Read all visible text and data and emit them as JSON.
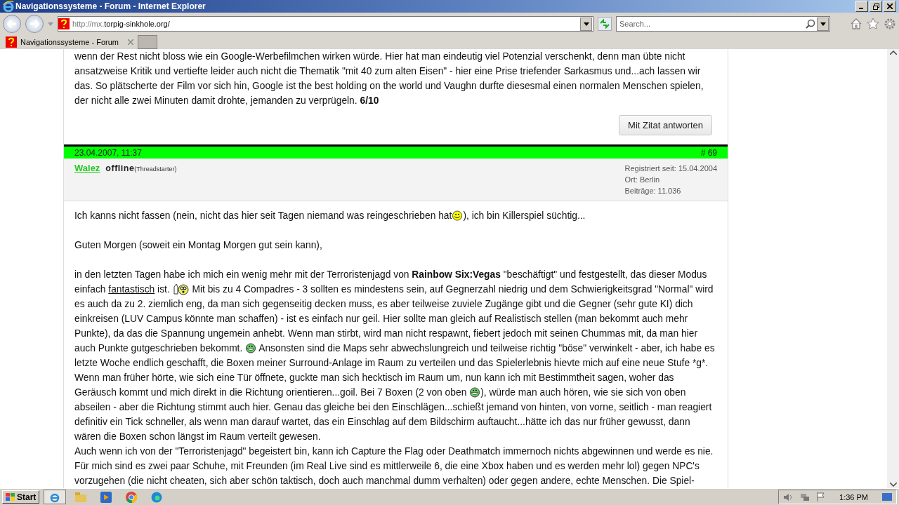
{
  "window": {
    "title": "Navigationssysteme - Forum - Internet Explorer"
  },
  "address": {
    "prefix": "http://mx.",
    "domain": "torpig-sinkhole.org/"
  },
  "search": {
    "placeholder": "Search..."
  },
  "tabs": [
    {
      "label": "Navigationssysteme - Forum",
      "selected": true
    }
  ],
  "previous_post": {
    "segments": [
      {
        "kind": "text",
        "text": "wenn der Rest nicht bloss wie ein Google-Werbefilmchen wirken würde. Hier hat man eindeutig viel Potenzial verschenkt, denn man übte nicht ansatzweise Kritik und vertiefte leider auch nicht die Thematik \"mit 40 zum alten Eisen\" - hier eine Prise triefender Sarkasmus und...ach lassen wir das. So plätscherte der Film vor sich hin, Google ist the best holding on the world und Vaughn durfte diesesmal einen normalen Menschen spielen, der nicht alle zwei Minuten damit drohte, jemanden zu verprügeln. **6/10**"
      }
    ],
    "quote_button": "Mit Zitat antworten"
  },
  "post": {
    "date": "23.04.2007, 11:37",
    "number": "# 69",
    "author": "Walez",
    "status": "offline",
    "role": "(Threadstarter)",
    "meta": [
      "Registriert seit: 15.04.2004",
      "Ort: Berlin",
      "Beiträge: 11.036"
    ],
    "paragraphs": [
      {
        "segments": [
          {
            "kind": "text",
            "text": "Ich kanns nicht fassen (nein, nicht das hier seit Tagen niemand was reingeschrieben hat"
          },
          {
            "kind": "smile"
          },
          {
            "kind": "text",
            "text": "), ich bin Killerspiel süchtig..."
          }
        ]
      },
      {
        "segments": [
          {
            "kind": "text",
            "text": "Guten Morgen (soweit ein Montag Morgen gut sein kann),"
          }
        ]
      },
      {
        "segments": [
          {
            "kind": "text",
            "text": "in den letzten Tagen habe ich mich ein wenig mehr mit der Terroristenjagd von **Rainbow Six:Vegas** \"beschäftigt\" und festgestellt, das dieser Modus einfach "
          },
          {
            "kind": "link",
            "text": "fantastisch"
          },
          {
            "kind": "text",
            "text": " ist. "
          },
          {
            "kind": "wow"
          },
          {
            "kind": "text",
            "text": " Mit bis zu 4 Compadres - 3 sollten es mindestens sein, auf Gegnerzahl niedrig und dem Schwierigkeitsgrad \"Normal\" wird es auch da zu 2. ziemlich eng, da man sich gegenseitig decken muss, es aber teilweise zuviele Zugänge gibt und die Gegner (sehr gute KI) dich einkreisen (LUV Campus könnte man schaffen) - ist es einfach nur geil. Hier sollte man gleich auf Realistisch stellen (man bekommt auch mehr Punkte), da das die Spannung ungemein anhebt. Wenn man stirbt, wird man nicht respawnt, fiebert jedoch mit seinen Chummas mit, da man hier auch Punkte gutgeschrieben bekommt. "
          },
          {
            "kind": "grin"
          },
          {
            "kind": "plain",
            "text": " Ansonsten sind die Maps sehr abwechslungreich und teilweise richtig \"böse\" verwinkelt - aber, ich habe es letzte Woche endlich geschafft, die Boxen meiner Surround-Anlage im Raum zu verteilen und das Spielerlebnis hievte mich auf eine neue Stufe *g*. Wenn man früher hörte, wie sich eine Tür öffnete, guckte man sich hecktisch im Raum um, nun kann ich mit Bestimmtheit sagen, woher das Geräusch kommt und mich direkt in die Richtung orientieren...goil. Bei 7 Boxen (2 von oben "
          },
          {
            "kind": "grin"
          },
          {
            "kind": "text",
            "text": "), würde man auch hören, wie sie sich von oben abseilen - aber die Richtung stimmt auch hier. Genau das gleiche bei den Einschlägen...schießt jemand von hinten, von vorne, seitlich - man reagiert definitiv ein Tick schneller, als wenn man darauf wartet, das ein Einschlag auf dem Bildschirm auftaucht...hätte ich das nur früher gewusst, dann wären die Boxen schon längst im Raum verteilt gewesen."
          }
        ]
      },
      {
        "segments": [
          {
            "kind": "text",
            "text": "Auch wenn ich von der \"Terroristenjagd\" begeistert bin, kann ich Capture the Flag oder Deathmatch immernoch nichts abgewinnen und werde es nie. Für mich sind es zwei paar Schuhe, mit Freunden (im Real Live sind es mittlerweile 6, die eine Xbox haben und es werden mehr lol) gegen NPC's vorzugehen (die nicht cheaten, sich aber schön taktisch, doch auch manchmal dumm verhalten) oder gegen andere, echte Menschen. Die Spiel-"
          }
        ]
      }
    ]
  },
  "taskbar": {
    "start": "Start",
    "clock": "1:36 PM"
  }
}
